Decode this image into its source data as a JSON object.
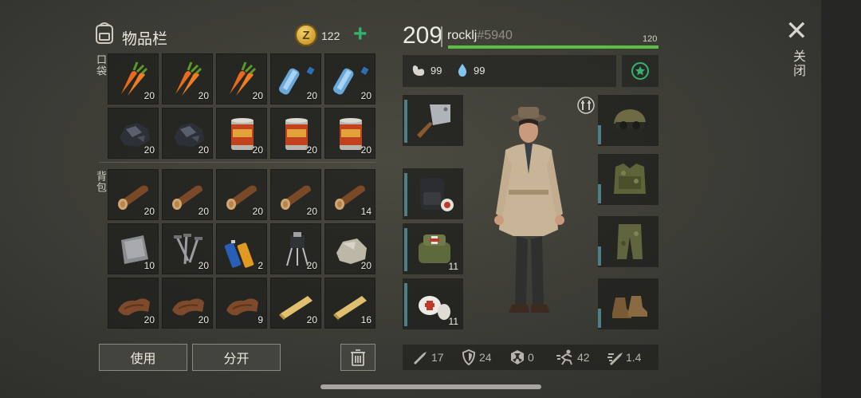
{
  "inventory": {
    "title": "物品栏",
    "coins": "122",
    "coin_symbol": "Z",
    "pocket_label": "口袋",
    "backpack_label": "背包",
    "pocket_items": [
      {
        "icon": "carrot-icon",
        "count": "20"
      },
      {
        "icon": "carrot-icon",
        "count": "20"
      },
      {
        "icon": "carrot-icon",
        "count": "20"
      },
      {
        "icon": "water-bottle-icon",
        "count": "20"
      },
      {
        "icon": "water-bottle-icon",
        "count": "20"
      },
      {
        "icon": "coal-icon",
        "count": "20"
      },
      {
        "icon": "coal-icon",
        "count": "20"
      },
      {
        "icon": "canned-food-icon",
        "count": "20"
      },
      {
        "icon": "canned-food-icon",
        "count": "20"
      },
      {
        "icon": "canned-food-icon",
        "count": "20"
      }
    ],
    "backpack_items": [
      {
        "icon": "log-icon",
        "count": "20"
      },
      {
        "icon": "log-icon",
        "count": "20"
      },
      {
        "icon": "log-icon",
        "count": "20"
      },
      {
        "icon": "log-icon",
        "count": "20"
      },
      {
        "icon": "log-icon",
        "count": "14"
      },
      {
        "icon": "metal-plate-icon",
        "count": "10"
      },
      {
        "icon": "nails-icon",
        "count": "20"
      },
      {
        "icon": "battery-icon",
        "count": "2"
      },
      {
        "icon": "transistor-icon",
        "count": "20"
      },
      {
        "icon": "stone-icon",
        "count": "20"
      },
      {
        "icon": "leather-icon",
        "count": "20"
      },
      {
        "icon": "leather-icon",
        "count": "20"
      },
      {
        "icon": "leather-icon",
        "count": "9"
      },
      {
        "icon": "plank-icon",
        "count": "20"
      },
      {
        "icon": "plank-icon",
        "count": "16"
      }
    ],
    "use_button": "使用",
    "split_button": "分开"
  },
  "character": {
    "level": "209",
    "username": "rocklj",
    "tag": "#5940",
    "hp_max": "120",
    "hp_fraction": 1.0,
    "food": "99",
    "water": "99"
  },
  "equipment": {
    "left": [
      {
        "icon": "cleaver-icon",
        "count": ""
      },
      {
        "icon": "backpack-icon",
        "count": ""
      },
      {
        "icon": "medkit-bag-icon",
        "count": "11"
      },
      {
        "icon": "bandage-icon",
        "count": "11"
      }
    ],
    "right": [
      "camo-cap-icon",
      "camo-vest-icon",
      "camo-pants-icon",
      "boots-icon"
    ]
  },
  "stats": {
    "attack": "17",
    "defense": "24",
    "radiation": "0",
    "speed": "42",
    "attack_speed": "1.4"
  },
  "close_label": "关闭",
  "colors": {
    "hp": "#5bbf3f",
    "accent": "#34b36e",
    "slot_bar": "#4e7f86"
  }
}
